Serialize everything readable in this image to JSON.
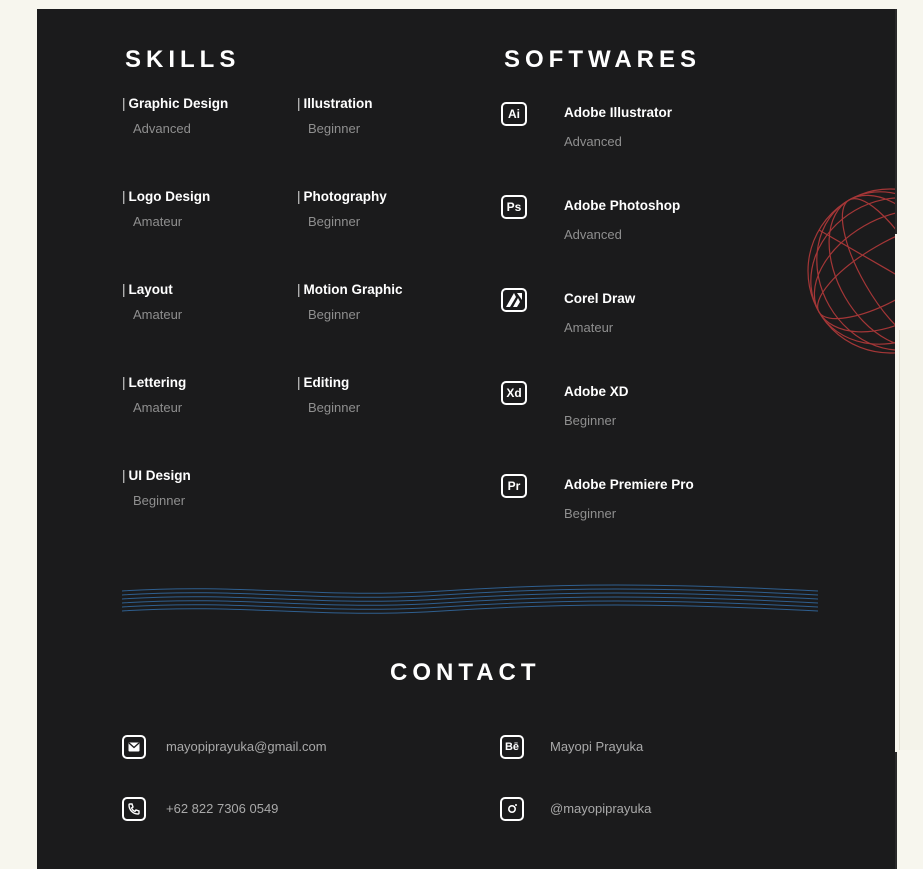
{
  "skills": {
    "title": "SKILLS",
    "items": [
      {
        "name": "Graphic Design",
        "level": "Advanced"
      },
      {
        "name": "Illustration",
        "level": "Beginner"
      },
      {
        "name": "Logo Design",
        "level": "Amateur"
      },
      {
        "name": "Photography",
        "level": "Beginner"
      },
      {
        "name": "Layout",
        "level": "Amateur"
      },
      {
        "name": "Motion Graphic",
        "level": "Beginner"
      },
      {
        "name": "Lettering",
        "level": "Amateur"
      },
      {
        "name": "Editing",
        "level": "Beginner"
      },
      {
        "name": "UI Design",
        "level": "Beginner"
      }
    ]
  },
  "softwares": {
    "title": "SOFTWARES",
    "items": [
      {
        "icon": "Ai",
        "name": "Adobe Illustrator",
        "level": "Advanced"
      },
      {
        "icon": "Ps",
        "name": "Adobe Photoshop",
        "level": "Advanced"
      },
      {
        "icon": "coreldraw-icon",
        "name": "Corel Draw",
        "level": "Amateur"
      },
      {
        "icon": "Xd",
        "name": "Adobe XD",
        "level": "Beginner"
      },
      {
        "icon": "Pr",
        "name": "Adobe Premiere Pro",
        "level": "Beginner"
      }
    ]
  },
  "contact": {
    "title": "CONTACT",
    "email": "mayopiprayuka@gmail.com",
    "phone": "+62 822 7306 0549",
    "behance": "Mayopi Prayuka",
    "behance_icon": "Bē",
    "instagram": "@mayopiprayuka"
  },
  "colors": {
    "background": "#1b1b1c",
    "text": "#ffffff",
    "muted": "#8f8f8f",
    "wave": "#2f5f8f",
    "globe": "#b33a3a"
  }
}
